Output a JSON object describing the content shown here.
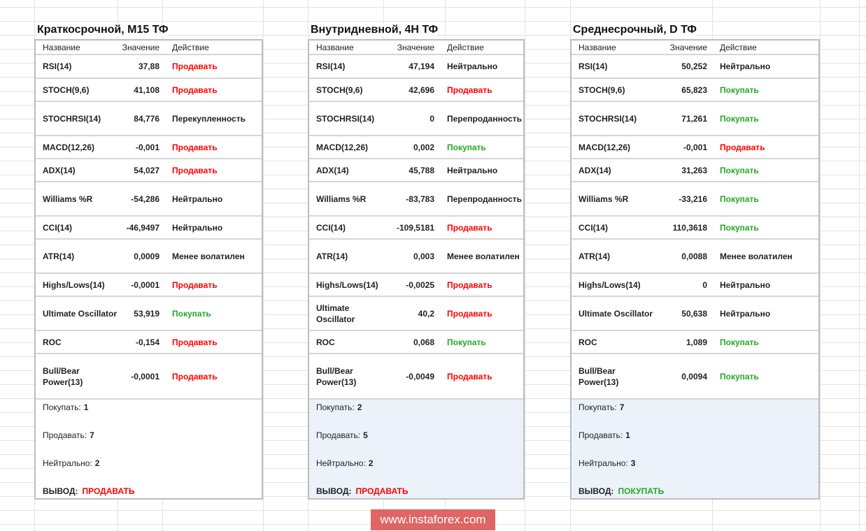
{
  "colors": {
    "sell": "#ff0000",
    "buy": "#22aa22",
    "summary_bg": "#ebf2f9"
  },
  "headers": {
    "name": "Название",
    "value": "Значение",
    "action": "Действие"
  },
  "labels": {
    "buy": "Покупать:",
    "sell": "Продавать:",
    "neutral": "Нейтрально:",
    "conclusion": "ВЫВОД:"
  },
  "watermark": "www.instaforex.com",
  "tables": [
    {
      "title": "Краткосрочной, M15 ТФ",
      "rows": [
        {
          "name": "RSI(14)",
          "value": "37,88",
          "action": "Продавать",
          "type": "sell"
        },
        {
          "name": "STOCH(9,6)",
          "value": "41,108",
          "action": "Продавать",
          "type": "sell"
        },
        {
          "name": "STOCHRSI(14)",
          "value": "84,776",
          "action": "Перекупленность",
          "type": "neutral"
        },
        {
          "name": "MACD(12,26)",
          "value": "-0,001",
          "action": "Продавать",
          "type": "sell"
        },
        {
          "name": "ADX(14)",
          "value": "54,027",
          "action": "Продавать",
          "type": "sell"
        },
        {
          "name": "Williams %R",
          "value": "-54,286",
          "action": "Нейтрально",
          "type": "neutral"
        },
        {
          "name": "CCI(14)",
          "value": "-46,9497",
          "action": "Нейтрально",
          "type": "neutral"
        },
        {
          "name": "ATR(14)",
          "value": "0,0009",
          "action": "Менее волатилен",
          "type": "neutral"
        },
        {
          "name": "Highs/Lows(14)",
          "value": "-0,0001",
          "action": "Продавать",
          "type": "sell"
        },
        {
          "name": "Ultimate Oscillator",
          "value": "53,919",
          "action": "Покупать",
          "type": "buy"
        },
        {
          "name": "ROC",
          "value": "-0,154",
          "action": "Продавать",
          "type": "sell"
        },
        {
          "name": "Bull/Bear Power(13)",
          "value": "-0,0001",
          "action": "Продавать",
          "type": "sell"
        }
      ],
      "summary": {
        "buy": "1",
        "sell": "7",
        "neutral": "2",
        "conclusion": "ПРОДАВАТЬ",
        "type": "sell"
      }
    },
    {
      "title": "Внутридневной, 4H ТФ",
      "rows": [
        {
          "name": "RSI(14)",
          "value": "47,194",
          "action": "Нейтрально",
          "type": "neutral"
        },
        {
          "name": "STOCH(9,6)",
          "value": "42,696",
          "action": "Продавать",
          "type": "sell"
        },
        {
          "name": "STOCHRSI(14)",
          "value": "0",
          "action": "Перепроданность",
          "type": "neutral"
        },
        {
          "name": "MACD(12,26)",
          "value": "0,002",
          "action": "Покупать",
          "type": "buy"
        },
        {
          "name": "ADX(14)",
          "value": "45,788",
          "action": "Нейтрально",
          "type": "neutral"
        },
        {
          "name": "Williams %R",
          "value": "-83,783",
          "action": "Перепроданность",
          "type": "neutral"
        },
        {
          "name": "CCI(14)",
          "value": "-109,5181",
          "action": "Продавать",
          "type": "sell"
        },
        {
          "name": "ATR(14)",
          "value": "0,003",
          "action": "Менее волатилен",
          "type": "neutral"
        },
        {
          "name": "Highs/Lows(14)",
          "value": "-0,0025",
          "action": "Продавать",
          "type": "sell"
        },
        {
          "name": "Ultimate Oscillator",
          "value": "40,2",
          "action": "Продавать",
          "type": "sell"
        },
        {
          "name": "ROC",
          "value": "0,068",
          "action": "Покупать",
          "type": "buy"
        },
        {
          "name": "Bull/Bear Power(13)",
          "value": "-0,0049",
          "action": "Продавать",
          "type": "sell"
        }
      ],
      "summary": {
        "buy": "2",
        "sell": "5",
        "neutral": "2",
        "conclusion": "ПРОДАВАТЬ",
        "type": "sell"
      }
    },
    {
      "title": "Среднесрочный, D ТФ",
      "rows": [
        {
          "name": "RSI(14)",
          "value": "50,252",
          "action": "Нейтрально",
          "type": "neutral"
        },
        {
          "name": "STOCH(9,6)",
          "value": "65,823",
          "action": "Покупать",
          "type": "buy"
        },
        {
          "name": "STOCHRSI(14)",
          "value": "71,261",
          "action": "Покупать",
          "type": "buy"
        },
        {
          "name": "MACD(12,26)",
          "value": "-0,001",
          "action": "Продавать",
          "type": "sell"
        },
        {
          "name": "ADX(14)",
          "value": "31,263",
          "action": "Покупать",
          "type": "buy"
        },
        {
          "name": "Williams %R",
          "value": "-33,216",
          "action": "Покупать",
          "type": "buy"
        },
        {
          "name": "CCI(14)",
          "value": "110,3618",
          "action": "Покупать",
          "type": "buy"
        },
        {
          "name": "ATR(14)",
          "value": "0,0088",
          "action": "Менее волатилен",
          "type": "neutral"
        },
        {
          "name": "Highs/Lows(14)",
          "value": "0",
          "action": "Нейтрально",
          "type": "neutral"
        },
        {
          "name": "Ultimate Oscillator",
          "value": "50,638",
          "action": "Нейтрально",
          "type": "neutral"
        },
        {
          "name": "ROC",
          "value": "1,089",
          "action": "Покупать",
          "type": "buy"
        },
        {
          "name": "Bull/Bear Power(13)",
          "value": "0,0094",
          "action": "Покупать",
          "type": "buy"
        }
      ],
      "summary": {
        "buy": "7",
        "sell": "1",
        "neutral": "3",
        "conclusion": "ПОКУПАТЬ",
        "type": "buy"
      }
    }
  ]
}
